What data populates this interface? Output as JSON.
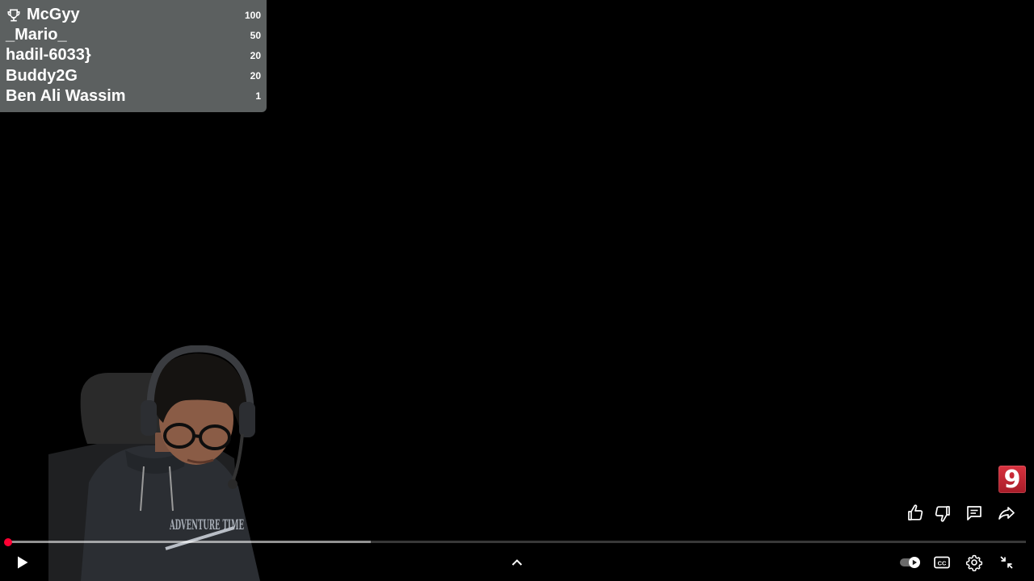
{
  "leaderboard": {
    "entries": [
      {
        "name": "McGyy",
        "score": "100"
      },
      {
        "name": "_Mario_",
        "score": "50"
      },
      {
        "name": "hadil-6033}",
        "score": "20"
      },
      {
        "name": "Buddy2G",
        "score": "20"
      },
      {
        "name": "Ben Ali Wassim",
        "score": "1"
      }
    ],
    "top_icon": "trophy-icon"
  },
  "webcam": {
    "hoodie_text": "ADVENTURE TIME"
  },
  "watermark": {
    "label": "9",
    "color": "#c8202f"
  },
  "actions": [
    {
      "icon": "like-icon"
    },
    {
      "icon": "dislike-icon"
    },
    {
      "icon": "comments-icon"
    },
    {
      "icon": "share-icon"
    }
  ],
  "progress": {
    "played_fraction": 0.0,
    "loaded_fraction": 0.356,
    "accent_color": "#ff0033"
  },
  "controls": {
    "left": [
      {
        "icon": "play-icon"
      }
    ],
    "center": [
      {
        "icon": "chevron-up-icon"
      }
    ],
    "right": [
      {
        "icon": "autoplay-toggle-icon"
      },
      {
        "icon": "captions-icon"
      },
      {
        "icon": "settings-gear-icon"
      },
      {
        "icon": "exit-fullscreen-icon"
      }
    ]
  }
}
